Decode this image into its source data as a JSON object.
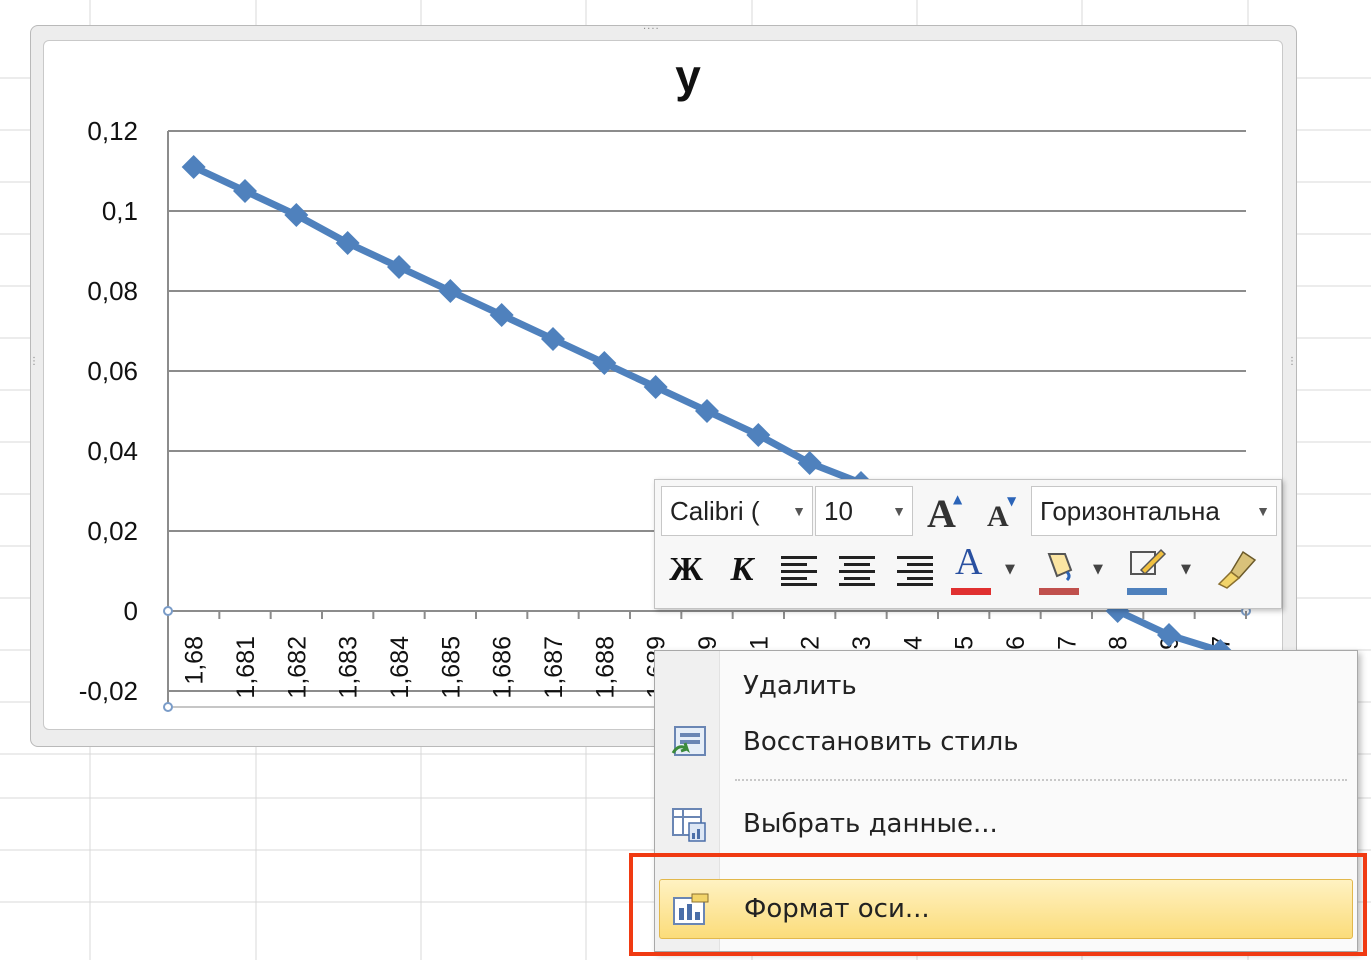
{
  "chart": {
    "title": "y",
    "y_ticks": [
      "0,12",
      "0,1",
      "0,08",
      "0,06",
      "0,04",
      "0,02",
      "0",
      "-0,02"
    ],
    "x_ticks": [
      "1,68",
      "1,681",
      "1,682",
      "1,683",
      "1,684",
      "1,685",
      "1,686",
      "1,687",
      "1,688",
      "1,689",
      "9",
      "1",
      "2",
      "3",
      "4",
      "5",
      "6",
      "7",
      "8",
      "9",
      "7"
    ]
  },
  "chart_data": {
    "type": "line",
    "title": "y",
    "xlabel": "",
    "ylabel": "",
    "categories": [
      "1,68",
      "1,681",
      "1,682",
      "1,683",
      "1,684",
      "1,685",
      "1,686",
      "1,687",
      "1,688",
      "1,689",
      "1,69",
      "1,691",
      "1,692",
      "1,693",
      "1,694",
      "1,695",
      "1,696",
      "1,697",
      "1,698",
      "1,699",
      "1,7"
    ],
    "series": [
      {
        "values": [
          0.111,
          0.105,
          0.099,
          0.092,
          0.086,
          0.08,
          0.074,
          0.068,
          0.062,
          0.056,
          0.05,
          0.044,
          0.037,
          0.032,
          0.026,
          0.02,
          0.014,
          0.008,
          0.0,
          -0.006,
          -0.01
        ]
      }
    ],
    "ylim": [
      -0.02,
      0.12
    ],
    "grid": true,
    "legend": "none",
    "color": "#4f81bd"
  },
  "mini_toolbar": {
    "font_name": "Calibri (",
    "font_size": "10",
    "grow_font": "A",
    "shrink_font": "A",
    "element_select": "Горизонтальна",
    "bold": "Ж",
    "italic": "К",
    "font_color": "A",
    "font_color_bar": "#e03030",
    "fill_color_bar": "#c0504d",
    "line_color_bar": "#4f81bd"
  },
  "context_menu": {
    "items": [
      {
        "label": "Удалить",
        "icon": "none"
      },
      {
        "label": "Восстановить стиль",
        "icon": "reset-style-icon"
      },
      {
        "label": "Выбрать данные...",
        "icon": "select-data-icon"
      },
      {
        "label": "Формат оси...",
        "icon": "format-axis-icon"
      }
    ]
  }
}
